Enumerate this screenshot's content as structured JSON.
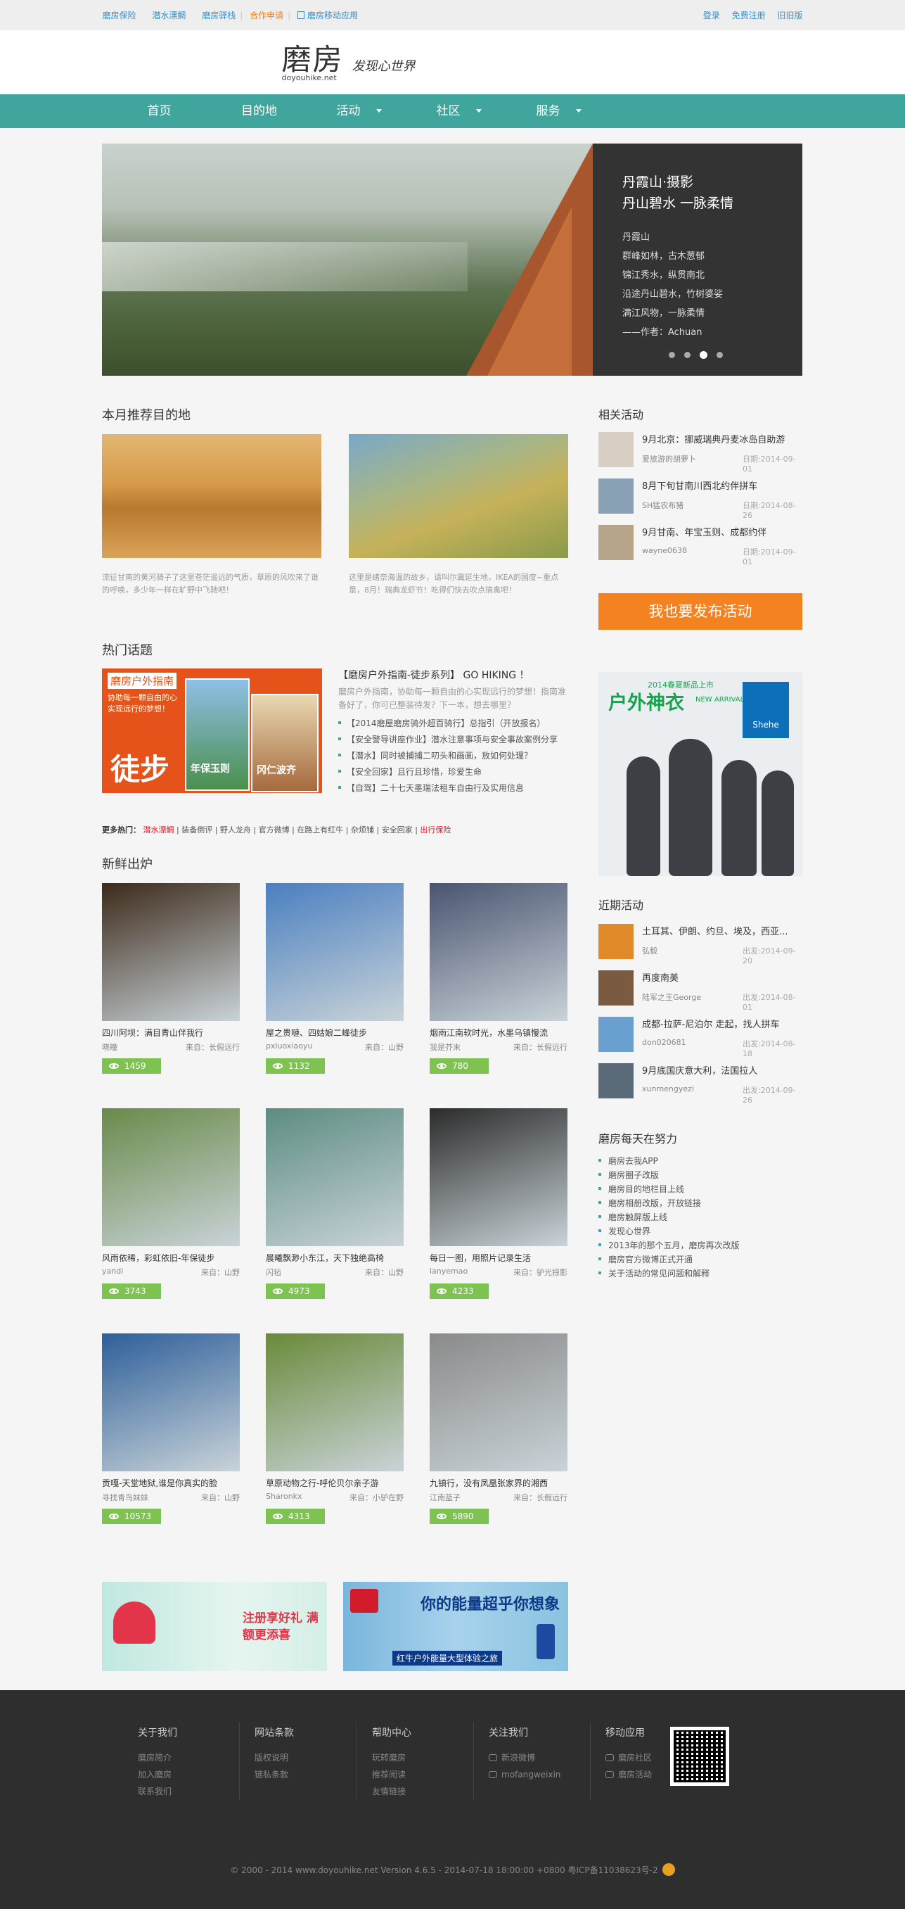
{
  "topbar": {
    "links": [
      "磨房保险",
      "潜水漂鲷",
      "磨房驿栈",
      "合作申请",
      "磨房移动应用"
    ],
    "user_links": [
      "登录",
      "免费注册",
      "旧旧版"
    ]
  },
  "header": {
    "logo_cn": "磨房",
    "logo_en": "doyouhike.net",
    "slogan": "发现心世界"
  },
  "nav": {
    "items": [
      "首页",
      "目的地",
      "活动",
      "社区",
      "服务"
    ]
  },
  "banner": {
    "title_line1": "丹霞山·摄影",
    "title_line2": "丹山碧水 一脉柔情",
    "desc": [
      "丹霞山",
      "群峰如林，古木葱郁",
      "锦江秀水，纵贯南北",
      "沿途丹山碧水，竹树婆娑",
      "满江风物，一脉柔情",
      "——作者：Achuan"
    ],
    "slide_count": 4,
    "active_slide": 3
  },
  "destinations": {
    "title": "本月推荐目的地",
    "items": [
      {
        "text": "流征甘南的黄河骑子了这里苍茫遥远的气质，草原的风吹来了谁的呼唤，多少年一样在旷野中飞驰吧！"
      },
      {
        "text": "这里是绪奈海温的故乡，请叫尔冀延生地，IKEA的国度~重点是，8月！瑞典龙虾节！吃得们快去吹点搞禽吧！"
      }
    ]
  },
  "hot": {
    "title": "热门话题",
    "img_label": "磨房户外指南",
    "img_sub": "协助每一颗自由的心实现远行的梦想！",
    "img_big": "徒步",
    "book1": "年保玉则",
    "book2": "冈仁波齐",
    "headline": "【磨房户外指南-徒步系列】 GO HIKING ！",
    "desc": "磨房户外指南，协助每一颗自由的心实现远行的梦想！指南准备好了，你可已整装待发？下一本，想去哪里？",
    "list": [
      "【2014磨屋磨房骑外超百骑行】总指引（开放报名）",
      "【安全警导讲座作业】潜水注意事项与安全事故案例分享",
      "【潜水】同时被捕捕二叨头和画画，放如何处理？",
      "【安全回家】且行且珍惜，珍爱生命",
      "【自驾】二十七天墨瑞法租车自由行及实用信息"
    ],
    "more_label": "更多热门：",
    "more_first": "潜水漂鲷",
    "more_items": [
      "装备倒评",
      "野人龙舟",
      "官方微博",
      "在路上有红牛",
      "杂烦铺",
      "安全回家"
    ],
    "more_last": "出行保险"
  },
  "fresh": {
    "title": "新鲜出炉",
    "items": [
      {
        "title": "四川阿坝：满目青山伴我行",
        "user": "晓瞳",
        "src": "长假远行",
        "views": "1459",
        "color": "#3c2a1a"
      },
      {
        "title": "屋之贵嗹、四姑娘二峰徒步",
        "user": "pxluoxiaoyu",
        "src": "山野",
        "views": "1132",
        "color": "#4a7fc0"
      },
      {
        "title": "烟雨江南软时光，水墨乌镇慢流",
        "user": "我是芥末",
        "src": "长假远行",
        "views": "780",
        "color": "#4a5470"
      },
      {
        "title": "风雨依稀，彩虹依旧-年保徒步",
        "user": "yandi",
        "src": "山野",
        "views": "3743",
        "color": "#6a8a4a"
      },
      {
        "title": "晨曦飘渺小东江，天下独绝高椅",
        "user": "闪毡",
        "src": "山野",
        "views": "4973",
        "color": "#5c8c82"
      },
      {
        "title": "每日一图，用照片记录生活",
        "user": "lanyemao",
        "src": "驴光掠影",
        "views": "4233",
        "color": "#2b2b2b"
      },
      {
        "title": "贡嘎-天堂地狱,谁是你真实的脸",
        "user": "寻找青鸟妹妹",
        "src": "山野",
        "views": "10573",
        "color": "#2e5f9a"
      },
      {
        "title": "草原动物之行-呼伦贝尔亲子游",
        "user": "Sharonkx",
        "src": "小驴在野",
        "views": "4313",
        "color": "#6a8a3a"
      },
      {
        "title": "九镇行，没有凤凰张家界的湘西",
        "user": "江南蓝子",
        "src": "长假远行",
        "views": "5890",
        "color": "#8a8a8a"
      }
    ],
    "src_label": "来自："
  },
  "ads": {
    "left_text": "注册享好礼 满额更添喜",
    "right_text": "你的能量超乎你想象",
    "right_sub": "红牛户外能量大型体验之旅"
  },
  "sidebar": {
    "related_title": "相关活动",
    "related": [
      {
        "title": "9月北京：挪威瑞典丹麦冰岛自助游",
        "user": "爱旅游的胡萝卜",
        "date": "日期:2014-09-01"
      },
      {
        "title": "8月下旬甘南川西北约伴拼车",
        "user": "SH猛农布猪",
        "date": "日期:2014-08-26"
      },
      {
        "title": "9月甘南、年宝玉则、成都约伴",
        "user": "wayne0638",
        "date": "日期:2014-09-01"
      }
    ],
    "publish_btn": "我也要发布活动",
    "ad_green": "户外神衣",
    "ad_year": "2014春夏新品上市",
    "ad_arrival": "NEW ARRIVAL",
    "ad_brand": "Shehe",
    "recent_title": "近期活动",
    "recent": [
      {
        "title": "土耳其、伊朗、约旦、埃及，西亚...",
        "user": "弘毅",
        "date": "出发:2014-09-20"
      },
      {
        "title": "再度南美",
        "user": "陆军之王George",
        "date": "出发:2014-08-01"
      },
      {
        "title": "成都-拉萨-尼泊尔 走起，找人拼车",
        "user": "don020681",
        "date": "出发:2014-08-18"
      },
      {
        "title": "9月底国庆意大利，法国拉人",
        "user": "xunmengyezi",
        "date": "出发:2014-09-26"
      }
    ],
    "daily_title": "磨房每天在努力",
    "daily": [
      "磨房去我APP",
      "磨房圈子改版",
      "磨房目的地栏目上线",
      "磨房相册改版，开放链接",
      "磨房触屏版上线",
      "发现心世界",
      "2013年的那个五月，磨房再次改版",
      "磨房官方微博正式开通",
      "关于活动的常见问题和解释"
    ]
  },
  "footer": {
    "cols": [
      {
        "title": "关于我们",
        "items": [
          "磨房简介",
          "加入磨房",
          "联系我们"
        ]
      },
      {
        "title": "网站条款",
        "items": [
          "版权说明",
          "链私条款"
        ]
      },
      {
        "title": "帮助中心",
        "items": [
          "玩转磨房",
          "推荐阅读",
          "友情链接"
        ]
      },
      {
        "title": "关注我们",
        "items": [
          "新浪微博",
          "mofangweixin"
        ]
      },
      {
        "title": "移动应用",
        "items": [
          "磨房社区",
          "磨房活动"
        ]
      }
    ],
    "copyright": "© 2000 - 2014 www.doyouhike.net Version 4.6.5 - 2014-07-18 18:00:00 +0800 粤ICP备11038623号-2"
  }
}
